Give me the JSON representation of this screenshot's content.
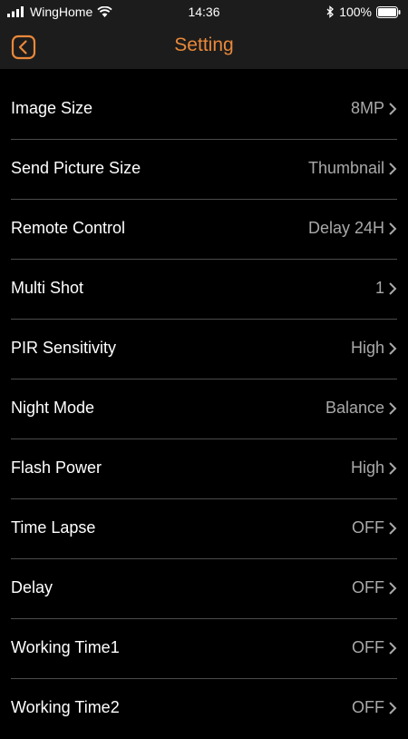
{
  "status_bar": {
    "carrier": "WingHome",
    "time": "14:36",
    "battery": "100%",
    "icons": [
      "signal-icon",
      "wifi-icon",
      "bluetooth-icon",
      "battery-icon"
    ]
  },
  "header": {
    "title": "Setting",
    "back_icon": "back-arrow-icon",
    "accent_color": "#e9883a"
  },
  "settings": [
    {
      "label": "Image Size",
      "value": "8MP"
    },
    {
      "label": "Send Picture Size",
      "value": "Thumbnail"
    },
    {
      "label": "Remote Control",
      "value": "Delay 24H"
    },
    {
      "label": "Multi Shot",
      "value": "1"
    },
    {
      "label": "PIR Sensitivity",
      "value": "High"
    },
    {
      "label": "Night Mode",
      "value": "Balance"
    },
    {
      "label": "Flash Power",
      "value": "High"
    },
    {
      "label": "Time Lapse",
      "value": "OFF"
    },
    {
      "label": "Delay",
      "value": "OFF"
    },
    {
      "label": "Working Time1",
      "value": "OFF"
    },
    {
      "label": "Working Time2",
      "value": "OFF"
    }
  ]
}
